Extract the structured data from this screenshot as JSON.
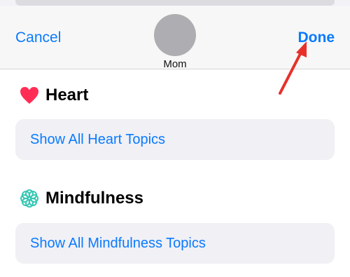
{
  "header": {
    "cancel_label": "Cancel",
    "done_label": "Done",
    "profile_name": "Mom"
  },
  "sections": [
    {
      "icon": "heart-icon",
      "title": "Heart",
      "link_label": "Show All Heart Topics",
      "accent": "#ff2d55"
    },
    {
      "icon": "mindfulness-icon",
      "title": "Mindfulness",
      "link_label": "Show All Mindfulness Topics",
      "accent": "#35c7b4"
    }
  ],
  "colors": {
    "link": "#0a7aff",
    "annotation_arrow": "#e8302a"
  }
}
